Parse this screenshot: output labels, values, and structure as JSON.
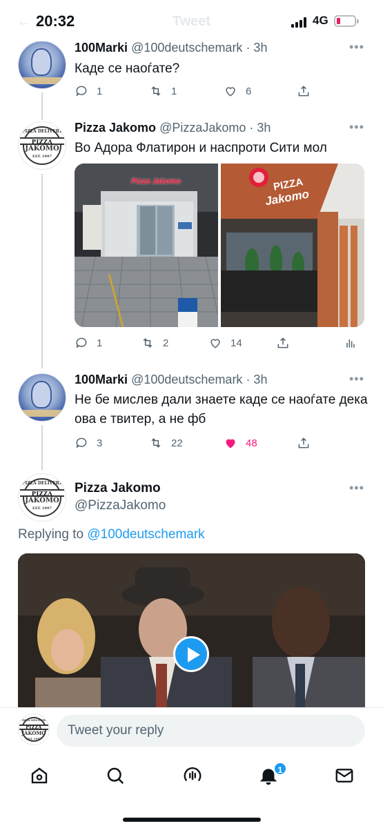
{
  "status": {
    "time": "20:32",
    "network": "4G",
    "faded_title": "Tweet",
    "faded_back": "←"
  },
  "tweets": [
    {
      "name": "100Marki",
      "handle_time": "@100deutschemark · 3h",
      "text": "Каде се наоѓате?",
      "replies": "1",
      "retweets": "1",
      "likes": "6"
    },
    {
      "name": "Pizza Jakomo",
      "handle_time": "@PizzaJakomo · 3h",
      "text": "Во Адора Флатирон и наспроти Сити мол",
      "replies": "1",
      "retweets": "2",
      "likes": "14",
      "image1_sign": "Pizza Jakomo",
      "image2_sign_line1": "PIZZA",
      "image2_sign_line2": "Jakomo"
    },
    {
      "name": "100Marki",
      "handle_time": "@100deutschemark · 3h",
      "text": "Не бе мислев дали знаете каде се наоѓате дека ова е твитер, а не фб",
      "replies": "3",
      "retweets": "22",
      "likes": "48",
      "liked_color": "#f91880"
    }
  ],
  "focused": {
    "name": "Pizza Jakomo",
    "handle": "@PizzaJakomo",
    "replying_prefix": "Replying to",
    "replying_handle": "@100deutschemark"
  },
  "logo": {
    "top": "PIZZA DELIVERY",
    "bar": "PIZZA",
    "name": "JAKOMO",
    "est": "EST. 1997"
  },
  "reply": {
    "placeholder": "Tweet your reply"
  },
  "tabs": {
    "notifications_badge": "1"
  },
  "colors": {
    "accent": "#1d9bf0",
    "like": "#f91880"
  },
  "icons": [
    "reply-icon",
    "retweet-icon",
    "like-icon",
    "share-icon",
    "analytics-icon",
    "play-icon",
    "home-icon",
    "search-icon",
    "spaces-icon",
    "notifications-icon",
    "messages-icon"
  ]
}
